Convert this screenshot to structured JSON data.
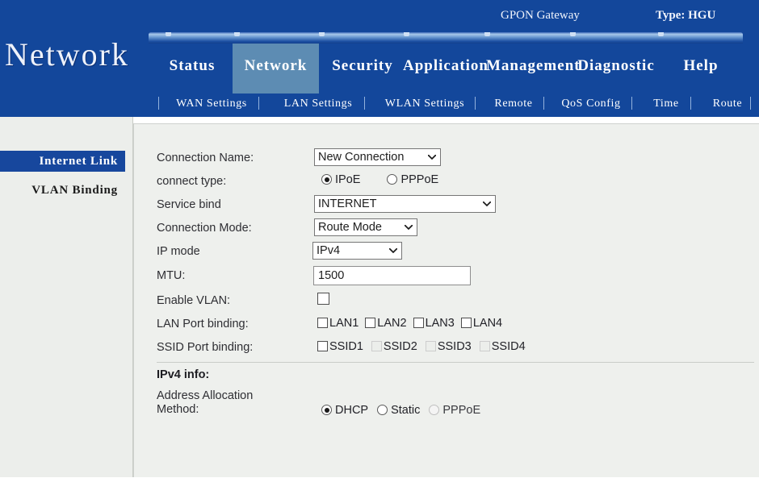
{
  "header": {
    "brand": "Network",
    "gateway_label": "GPON Gateway",
    "type_label": "Type: HGU",
    "bg_color": "#13479b",
    "active_tab_color": "#5d8cb3",
    "tabs": [
      {
        "label": "Status",
        "active": false
      },
      {
        "label": "Network",
        "active": true
      },
      {
        "label": "Security",
        "active": false
      },
      {
        "label": "Application",
        "active": false
      },
      {
        "label": "Management",
        "active": false
      },
      {
        "label": "Diagnostic",
        "active": false
      },
      {
        "label": "Help",
        "active": false
      }
    ],
    "subnav": [
      {
        "label": "WAN Settings"
      },
      {
        "label": "LAN Settings"
      },
      {
        "label": "WLAN Settings"
      },
      {
        "label": "Remote"
      },
      {
        "label": "QoS Config"
      },
      {
        "label": "Time"
      },
      {
        "label": "Route"
      }
    ]
  },
  "sidebar": {
    "items": [
      {
        "label": "Internet Link",
        "selected": true
      },
      {
        "label": "VLAN Binding",
        "selected": false
      }
    ],
    "selected_bg": "#17479d"
  },
  "form": {
    "connection_name": {
      "label": "Connection Name:",
      "value": "New Connection"
    },
    "connect_type": {
      "label": "connect type:",
      "options": [
        {
          "label": "IPoE",
          "checked": true,
          "disabled": false
        },
        {
          "label": "PPPoE",
          "checked": false,
          "disabled": false
        }
      ]
    },
    "service_bind": {
      "label": "Service bind",
      "value": "INTERNET"
    },
    "connection_mode": {
      "label": "Connection Mode:",
      "value": "Route Mode"
    },
    "ip_mode": {
      "label": "IP mode",
      "value": "IPv4"
    },
    "mtu": {
      "label": "MTU:",
      "value": "1500"
    },
    "enable_vlan": {
      "label": "Enable VLAN:",
      "checked": false
    },
    "lan_port_binding": {
      "label": "LAN Port binding:",
      "ports": [
        {
          "label": "LAN1",
          "checked": false,
          "disabled": false
        },
        {
          "label": "LAN2",
          "checked": false,
          "disabled": false
        },
        {
          "label": "LAN3",
          "checked": false,
          "disabled": false
        },
        {
          "label": "LAN4",
          "checked": false,
          "disabled": false
        }
      ]
    },
    "ssid_port_binding": {
      "label": "SSID Port binding:",
      "ports": [
        {
          "label": "SSID1",
          "checked": false,
          "disabled": false
        },
        {
          "label": "SSID2",
          "checked": false,
          "disabled": true
        },
        {
          "label": "SSID3",
          "checked": false,
          "disabled": true
        },
        {
          "label": "SSID4",
          "checked": false,
          "disabled": true
        }
      ]
    },
    "ipv4_section": {
      "title": "IPv4 info:",
      "address_allocation": {
        "label_line1": "Address Allocation",
        "label_line2": "Method:",
        "options": [
          {
            "label": "DHCP",
            "checked": true,
            "disabled": false
          },
          {
            "label": "Static",
            "checked": false,
            "disabled": false
          },
          {
            "label": "PPPoE",
            "checked": false,
            "disabled": true
          }
        ]
      }
    }
  }
}
